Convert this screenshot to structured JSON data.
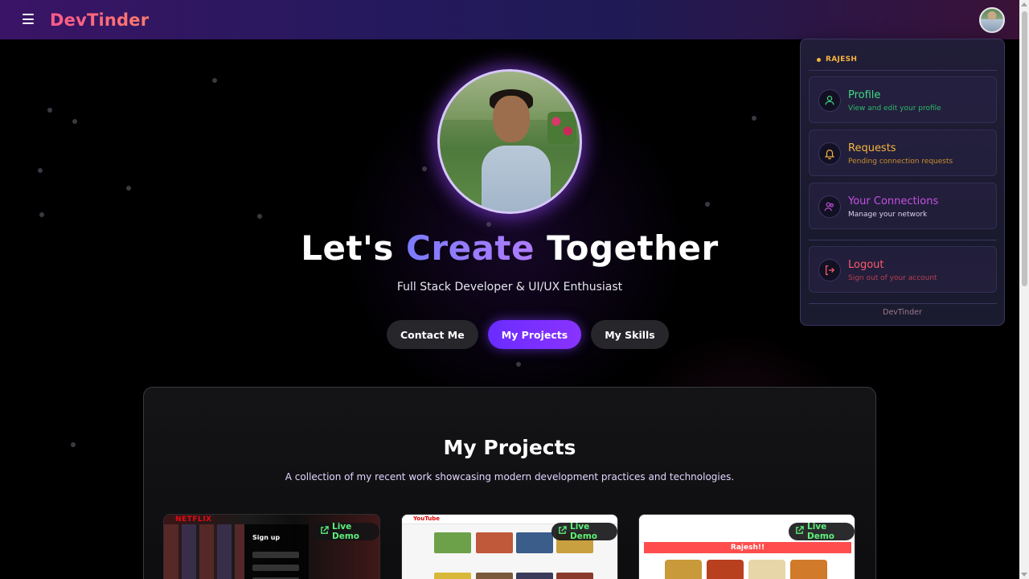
{
  "navbar": {
    "brand": "DevTinder"
  },
  "hero": {
    "title_part1": "Let's ",
    "title_accent": "Create",
    "title_part2": " Together",
    "subtitle": "Full Stack Developer & UI/UX Enthusiast",
    "buttons": [
      {
        "label": "Contact Me"
      },
      {
        "label": "My Projects"
      },
      {
        "label": "My Skills"
      }
    ]
  },
  "projects": {
    "title": "My Projects",
    "subtitle": "A collection of my recent work showcasing modern development practices and technologies.",
    "cards": [
      {
        "live_demo": "Live Demo",
        "logo": "NETFLIX",
        "form_title": "Sign up"
      },
      {
        "live_demo": "Live Demo",
        "logo": "YouTube"
      },
      {
        "live_demo": "Live Demo",
        "banner": "Rajesh!!"
      }
    ]
  },
  "dropdown": {
    "username": "RAJESH",
    "items": [
      {
        "label": "Profile",
        "description": "View and edit your profile",
        "color": "#3ddc84",
        "icon": "user-icon"
      },
      {
        "label": "Requests",
        "description": "Pending connection requests",
        "color": "#f5b43d",
        "icon": "bell-icon"
      },
      {
        "label": "Your Connections",
        "description": "Manage your network",
        "color": "#c651e0",
        "icon": "users-icon"
      },
      {
        "label": "Logout",
        "description": "Sign out of your account",
        "color": "#ff5a6e",
        "icon": "logout-icon"
      }
    ],
    "footer": "DevTinder"
  },
  "colors": {
    "brand_gradient_start": "#ff5a8a",
    "primary_button": "#6a2cff",
    "accent_text": "#7b7bff",
    "live_demo_green": "#5ef07a"
  }
}
